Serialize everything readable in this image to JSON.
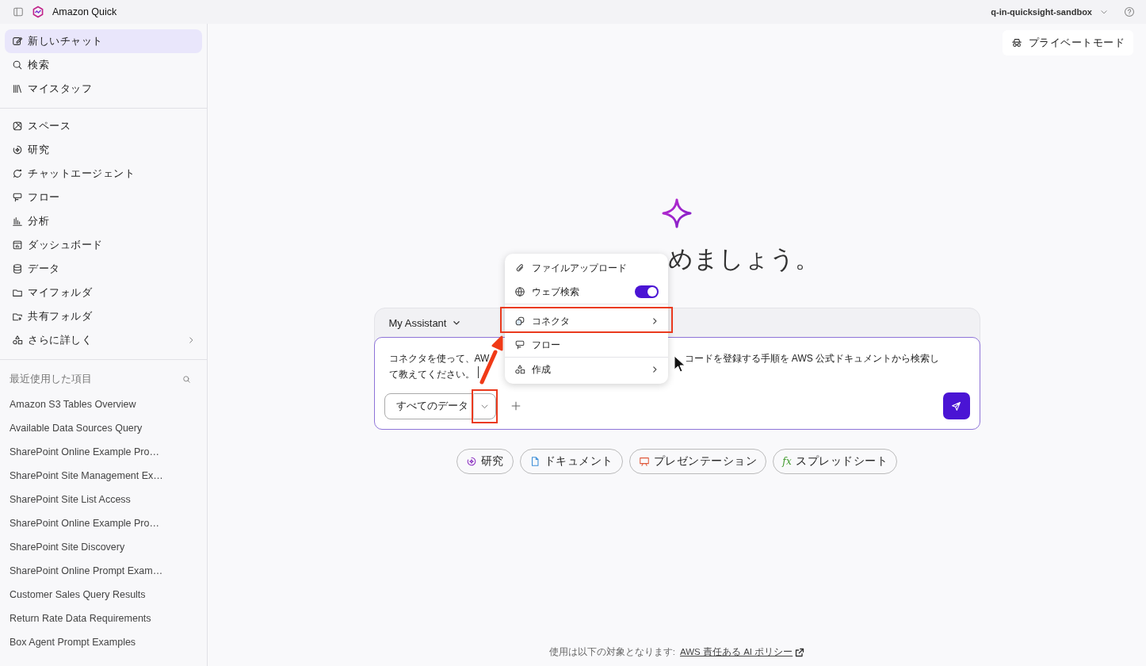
{
  "topbar": {
    "app_name": "Amazon Quick",
    "account": "q-in-quicksight-sandbox"
  },
  "sidebar": {
    "primary": [
      {
        "label": "新しいチャット",
        "selected": true
      },
      {
        "label": "検索",
        "selected": false
      },
      {
        "label": "マイスタッフ",
        "selected": false
      }
    ],
    "nav": [
      {
        "label": "スペース",
        "submenu": false
      },
      {
        "label": "研究",
        "submenu": false
      },
      {
        "label": "チャットエージェント",
        "submenu": false
      },
      {
        "label": "フロー",
        "submenu": false
      },
      {
        "label": "分析",
        "submenu": false
      },
      {
        "label": "ダッシュボード",
        "submenu": false
      },
      {
        "label": "データ",
        "submenu": false
      },
      {
        "label": "マイフォルダ",
        "submenu": false
      },
      {
        "label": "共有フォルダ",
        "submenu": false
      },
      {
        "label": "さらに詳しく",
        "submenu": true
      }
    ],
    "recent_title": "最近使用した項目",
    "recent": [
      "Amazon S3 Tables Overview",
      "Available Data Sources Query",
      "SharePoint Online Example Pro…",
      "SharePoint Site Management Ex…",
      "SharePoint Site List Access",
      "SharePoint Online Example Pro…",
      "SharePoint Site Discovery",
      "SharePoint Online Prompt Exam…",
      "Customer Sales Query Results",
      "Return Rate Data Requirements",
      "Box Agent Prompt Examples"
    ]
  },
  "private_mode": "プライベートモード",
  "heading": "めましょう。",
  "composer": {
    "agent": "My Assistant",
    "text_lines": [
      [
        "コネクタを使って、AW",
        "コードを登録する手順を AWS 公式ドキュメントから検索し"
      ],
      [
        "て教えてください。"
      ]
    ],
    "data_source": "すべてのデータ",
    "data_source_annotated": true
  },
  "menu": {
    "groups": [
      [
        {
          "kind": "action",
          "label": "ファイルアップロード",
          "annotated": false
        },
        {
          "kind": "toggle",
          "label": "ウェブ検索",
          "on": true,
          "annotated": false
        }
      ],
      [
        {
          "kind": "submenu",
          "label": "コネクタ",
          "annotated": true
        },
        {
          "kind": "action",
          "label": "フロー",
          "annotated": false
        }
      ],
      [
        {
          "kind": "submenu",
          "label": "作成",
          "annotated": false
        }
      ]
    ]
  },
  "chips": [
    {
      "label": "研究"
    },
    {
      "label": "ドキュメント"
    },
    {
      "label": "プレゼンテーション"
    },
    {
      "label": "スプレッドシート",
      "glyph": "fx"
    }
  ],
  "footer": {
    "text": "使用は以下の対象となります:",
    "link": "AWS 責任ある AI ポリシー"
  }
}
